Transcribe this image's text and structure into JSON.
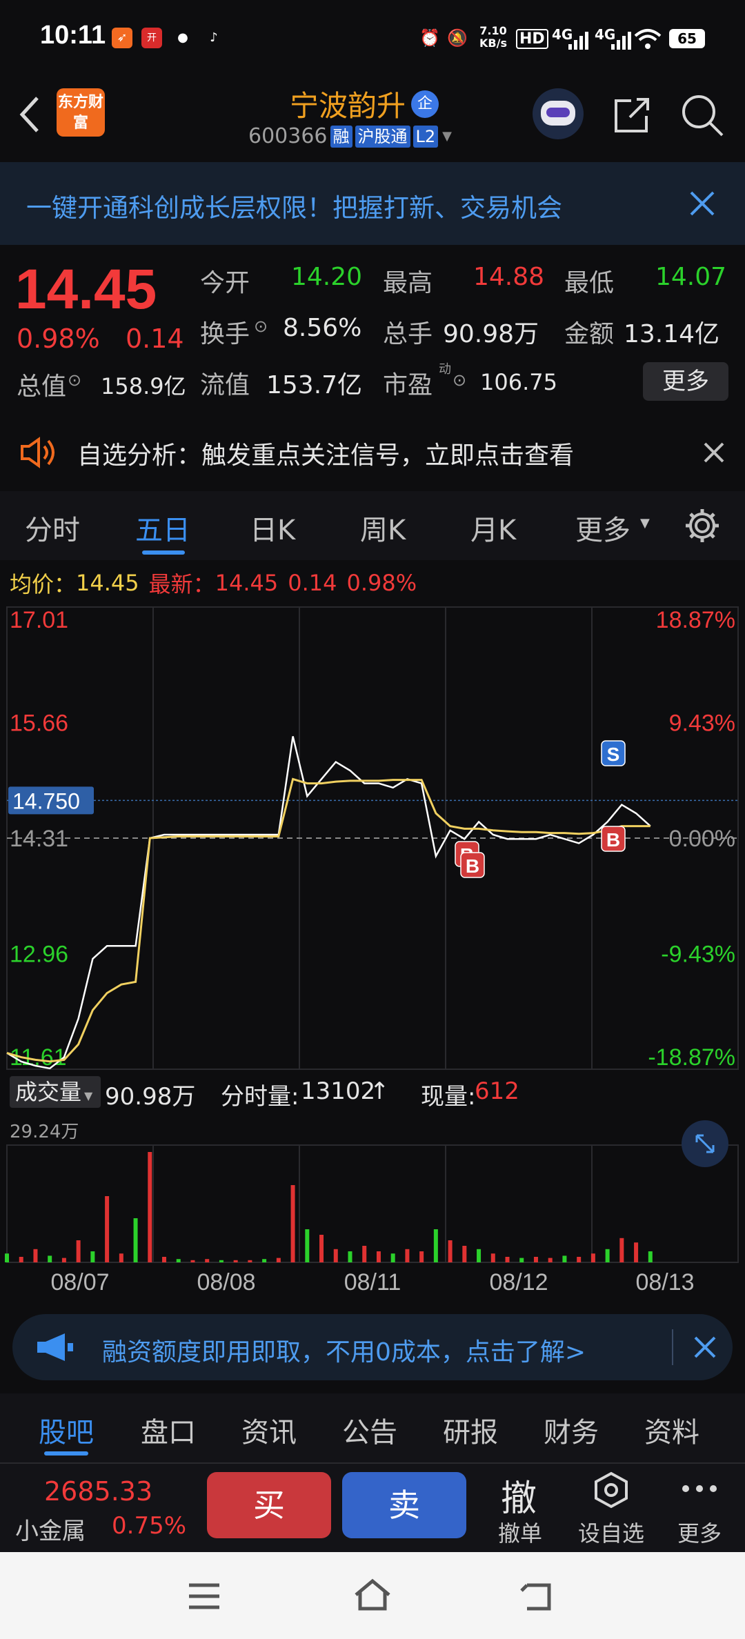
{
  "status_bar": {
    "time": "10:11",
    "net_speed_value": "7.10",
    "net_speed_unit": "KB/s",
    "hd": "HD",
    "signal1": "4G",
    "signal2": "4G",
    "battery": "65"
  },
  "header": {
    "back_icon": "chevron-left-icon",
    "logo_text": "东方财富",
    "stock_name": "宁波韵升",
    "enterprise_badge": "企",
    "stock_code": "600366",
    "tags": [
      "融",
      "沪股通",
      "L2"
    ]
  },
  "banner": {
    "text": "一键开通科创成长层权限！把握打新、交易机会"
  },
  "quote": {
    "price": "14.45",
    "change_pct": "0.98%",
    "change": "0.14",
    "open_label": "今开",
    "open": "14.20",
    "high_label": "最高",
    "high": "14.88",
    "low_label": "最低",
    "low": "14.07",
    "turnover_label": "换手",
    "turnover": "8.56%",
    "volume_label": "总手",
    "volume": "90.98万",
    "amount_label": "金额",
    "amount": "13.14亿",
    "mktcap_label": "总值",
    "mktcap": "158.9亿",
    "float_label": "流值",
    "float_cap": "153.7亿",
    "pe_label": "市盈",
    "pe_sup": "动",
    "pe": "106.75",
    "more_button": "更多"
  },
  "notice": {
    "text": "自选分析：触发重点关注信号，立即点击查看"
  },
  "chart_tabs": [
    "分时",
    "五日",
    "日K",
    "周K",
    "月K",
    "更多"
  ],
  "chart_info": {
    "avg_label": "均价：",
    "avg_value": "14.45",
    "latest_label": "最新：",
    "latest_value": "14.45",
    "latest_change": "0.14",
    "latest_pct": "0.98%"
  },
  "chart_data": {
    "type": "line",
    "title": "",
    "y_labels_left": [
      "17.01",
      "15.66",
      "14.31",
      "12.96",
      "11.61"
    ],
    "y_labels_right": [
      "18.87%",
      "9.43%",
      "0.00%",
      "-9.43%",
      "-18.87%"
    ],
    "ylim": [
      11.61,
      17.01
    ],
    "prev_close": 14.31,
    "crosshair_value": "14.750",
    "x_labels": [
      "08/07",
      "08/08",
      "08/11",
      "08/12",
      "08/13"
    ],
    "markers": [
      {
        "label": "S",
        "day": 5
      },
      {
        "label": "B",
        "day": 4
      },
      {
        "label": "B",
        "day": 4
      },
      {
        "label": "B",
        "day": 5
      }
    ],
    "series": [
      {
        "name": "price",
        "values": [
          11.8,
          11.7,
          11.65,
          11.62,
          11.75,
          12.2,
          12.9,
          13.05,
          13.05,
          13.05,
          14.31,
          14.35,
          14.35,
          14.35,
          14.35,
          14.35,
          14.35,
          14.35,
          14.35,
          14.35,
          15.5,
          14.8,
          15.0,
          15.2,
          15.1,
          14.95,
          14.95,
          14.9,
          15.0,
          14.95,
          14.1,
          14.4,
          14.3,
          14.5,
          14.35,
          14.3,
          14.3,
          14.3,
          14.35,
          14.3,
          14.25,
          14.35,
          14.5,
          14.7,
          14.6,
          14.45
        ]
      },
      {
        "name": "avg",
        "values": [
          11.8,
          11.75,
          11.72,
          11.7,
          11.72,
          11.9,
          12.3,
          12.5,
          12.6,
          12.63,
          14.31,
          14.32,
          14.33,
          14.33,
          14.33,
          14.33,
          14.33,
          14.33,
          14.33,
          14.33,
          15.0,
          14.95,
          14.95,
          14.97,
          14.98,
          14.98,
          14.98,
          14.99,
          14.99,
          14.99,
          14.6,
          14.45,
          14.42,
          14.42,
          14.4,
          14.39,
          14.38,
          14.38,
          14.37,
          14.37,
          14.36,
          14.37,
          14.4,
          14.45,
          14.45,
          14.45
        ]
      }
    ],
    "volume": {
      "label_btn": "成交量",
      "total": "90.98万",
      "minute_label": "分时量:",
      "minute_value": "13102",
      "current_label": "现量:",
      "current_value": "612",
      "max_label": "29.24万",
      "bars": [
        0.08,
        0.05,
        0.12,
        0.06,
        0.04,
        0.2,
        0.1,
        0.6,
        0.08,
        0.4,
        1.0,
        0.05,
        0.03,
        0.02,
        0.03,
        0.02,
        0.02,
        0.02,
        0.03,
        0.04,
        0.7,
        0.3,
        0.25,
        0.12,
        0.1,
        0.15,
        0.1,
        0.08,
        0.12,
        0.1,
        0.3,
        0.2,
        0.15,
        0.12,
        0.08,
        0.05,
        0.04,
        0.05,
        0.04,
        0.06,
        0.05,
        0.08,
        0.12,
        0.22,
        0.18,
        0.1
      ]
    }
  },
  "banner2": {
    "text": "融资额度即用即取，不用0成本，点击了解>"
  },
  "bottom_tabs": [
    "股吧",
    "盘口",
    "资讯",
    "公告",
    "研报",
    "财务",
    "资料"
  ],
  "trade_bar": {
    "index_value": "2685.33",
    "index_name": "小金属",
    "index_pct": "0.75%",
    "buy": "买",
    "sell": "卖",
    "cancel_big": "撤",
    "cancel": "撤单",
    "watch": "设自选",
    "more": "更多"
  }
}
